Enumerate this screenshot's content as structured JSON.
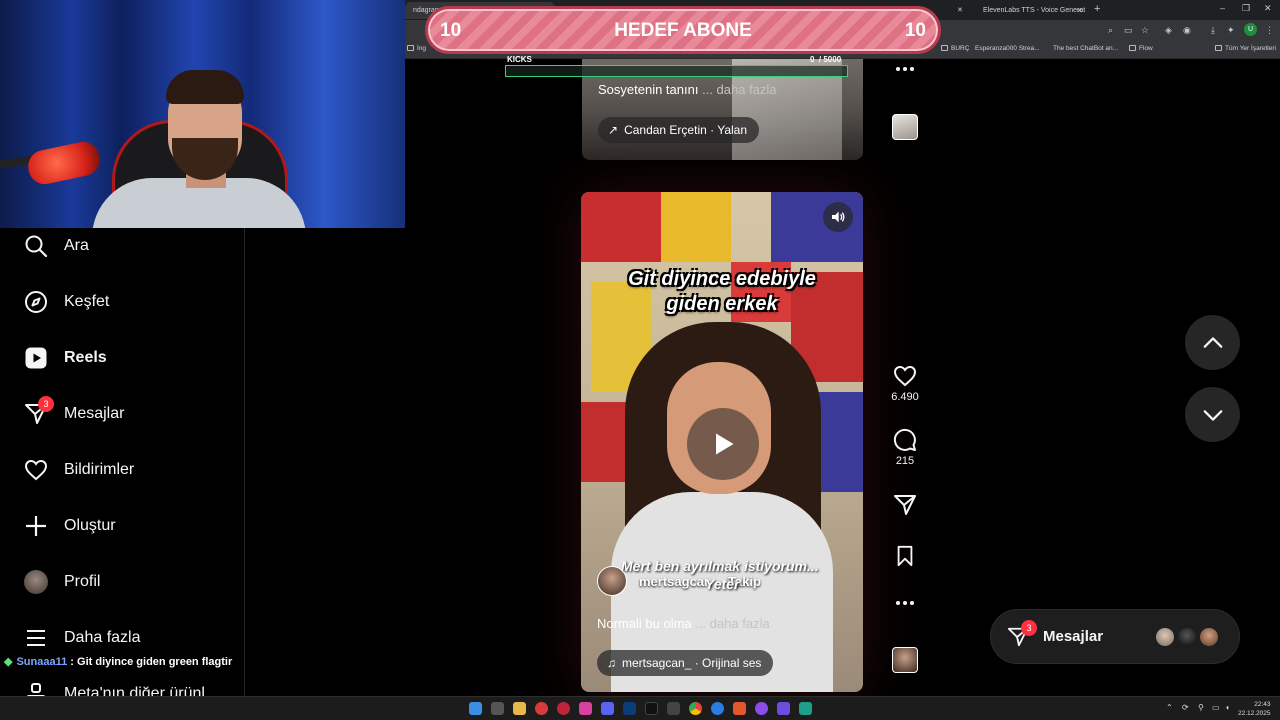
{
  "browser": {
    "tabs": [
      {
        "label": "ndagram",
        "active": true
      },
      {
        "label": "ElevenLabs TTS - Voice Generat",
        "active": false
      }
    ],
    "new_tab": "+",
    "window_controls": [
      "–",
      "❐",
      "✕"
    ],
    "bookmarks": [
      "İng",
      "BURÇ",
      "Esperanza000 Strea...",
      "The best ChatBot an...",
      "Flow",
      "Tüm Yer İşaretleri"
    ],
    "profile_initial": "U"
  },
  "goal": {
    "title": "HEDEF ABONE",
    "left_number": "10",
    "right_number": "10",
    "kicks_label": "KICKS",
    "kicks_count": "0",
    "kicks_total": "/ 5000",
    "kicks_progress": 0
  },
  "sidebar": {
    "items": [
      {
        "label": "Ara",
        "icon": "search-icon"
      },
      {
        "label": "Keşfet",
        "icon": "compass-icon"
      },
      {
        "label": "Reels",
        "icon": "reels-icon",
        "active": true
      },
      {
        "label": "Mesajlar",
        "icon": "messenger-icon",
        "badge": "3"
      },
      {
        "label": "Bildirimler",
        "icon": "heart-icon"
      },
      {
        "label": "Oluştur",
        "icon": "plus-icon"
      },
      {
        "label": "Profil",
        "icon": "avatar"
      },
      {
        "label": "Daha fazla",
        "icon": "menu-icon"
      },
      {
        "label": "Meta'nın diğer ürünl",
        "icon": "meta-icon"
      }
    ]
  },
  "chat": {
    "user": "Sunaaa11",
    "separator": " : ",
    "message": "Git diyince giden green flagtir"
  },
  "reel_previous": {
    "caption": "Sosyetenin tanını",
    "more": "... daha fazla",
    "link": "Candan Erçetin · Yalan"
  },
  "reel_current": {
    "overlay_line1": "Git diyince edebiyle",
    "overlay_line2": "giden erkek",
    "subtitle_line1": "Mert ben ayrılmak istiyorum...",
    "subtitle_line2": "Yeter",
    "author": "mertsagcan",
    "follow": "Takip",
    "caption": "Normali bu olma",
    "more": "... daha fazla",
    "audio": "mertsagcan_ · Orijinal ses"
  },
  "actions": {
    "likes": "6.490",
    "comments": "215"
  },
  "messages_panel": {
    "label": "Mesajlar",
    "badge": "3"
  },
  "taskbar": {
    "time": "22:43",
    "date": "22.12.2025"
  },
  "colors": {
    "badge": "#ff3040",
    "goal_pink": "#e88a99",
    "goal_border": "#b83a4e",
    "kicks_green": "#3ad07a",
    "chat_user": "#7fa6ff"
  }
}
